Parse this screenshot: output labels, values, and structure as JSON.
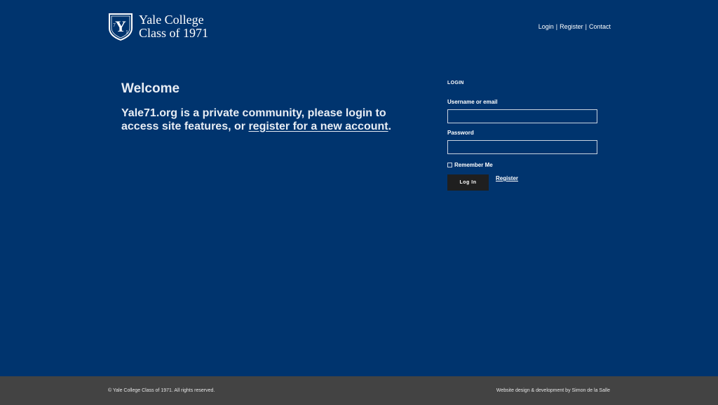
{
  "header": {
    "logo": {
      "monogram": "Y",
      "year_left": "7",
      "year_right": "1",
      "line1": "Yale College",
      "line2": "Class of 1971"
    },
    "nav": {
      "login": "Login",
      "sep1": "|",
      "register": "Register",
      "sep2": "|",
      "contact": "Contact"
    }
  },
  "welcome": {
    "title": "Welcome",
    "text_before": "Yale71.org is a private community, please login to access site features, or ",
    "register_link": "register for a new account",
    "text_after": "."
  },
  "login_form": {
    "heading": "LOGIN",
    "username_label": "Username or email",
    "username_value": "",
    "password_label": "Password",
    "password_value": "",
    "remember_label": "Remember Me",
    "remember_checked": false,
    "submit_label": "Log In",
    "register_label": "Register"
  },
  "footer": {
    "copyright": "© Yale College Class of 1971. All rights reserved.",
    "credit_prefix": "Website design & development by ",
    "credit_name": "Simon de la Salle"
  },
  "colors": {
    "background": "#00346e",
    "footer": "#434343",
    "button": "#1f1f1f",
    "text": "#ffffff"
  }
}
